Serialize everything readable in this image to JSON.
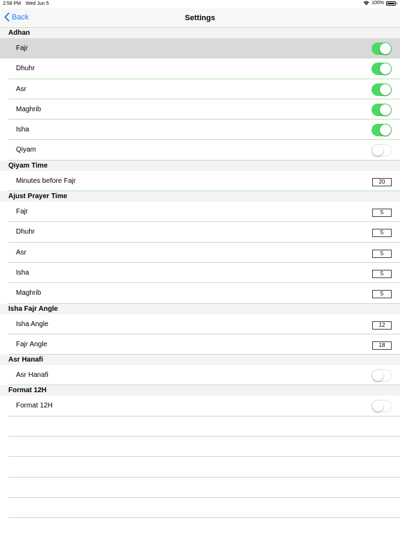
{
  "statusbar": {
    "time": "2:58 PM",
    "date": "Wed Jun 5",
    "battery": "100%"
  },
  "navbar": {
    "back_label": "Back",
    "title": "Settings"
  },
  "sections": {
    "adhan": {
      "header": "Adhan",
      "fajr": {
        "label": "Fajr",
        "on": true
      },
      "dhuhr": {
        "label": "Dhuhr",
        "on": true
      },
      "asr": {
        "label": "Asr",
        "on": true
      },
      "maghrib": {
        "label": "Maghrib",
        "on": true
      },
      "isha": {
        "label": "Isha",
        "on": true
      },
      "qiyam": {
        "label": "Qiyam",
        "on": false
      }
    },
    "qiyam_time": {
      "header": "Qiyam Time",
      "minutes": {
        "label": "Minutes before Fajr",
        "value": "20"
      }
    },
    "adjust": {
      "header": "Ajust Prayer Time",
      "fajr": {
        "label": "Fajr",
        "value": "5"
      },
      "dhuhr": {
        "label": "Dhuhr",
        "value": "5"
      },
      "asr": {
        "label": "Asr",
        "value": "5"
      },
      "isha": {
        "label": "Isha",
        "value": "5"
      },
      "maghrib": {
        "label": "Maghrib",
        "value": "5"
      }
    },
    "angle": {
      "header": "Isha Fajr Angle",
      "isha": {
        "label": "Isha Angle",
        "value": "12"
      },
      "fajr": {
        "label": "Fajr Angle",
        "value": "18"
      }
    },
    "hanafi": {
      "header": "Asr Hanafi",
      "asr_hanafi": {
        "label": "Asr Hanafi",
        "on": false
      }
    },
    "format": {
      "header": "Format 12H",
      "format12": {
        "label": "Format 12H",
        "on": false
      }
    }
  },
  "colors": {
    "accent": "#1a7cf5",
    "toggle_on": "#4cd964",
    "separator": "#bce5b6",
    "selected_row": "#d9d9d9"
  }
}
